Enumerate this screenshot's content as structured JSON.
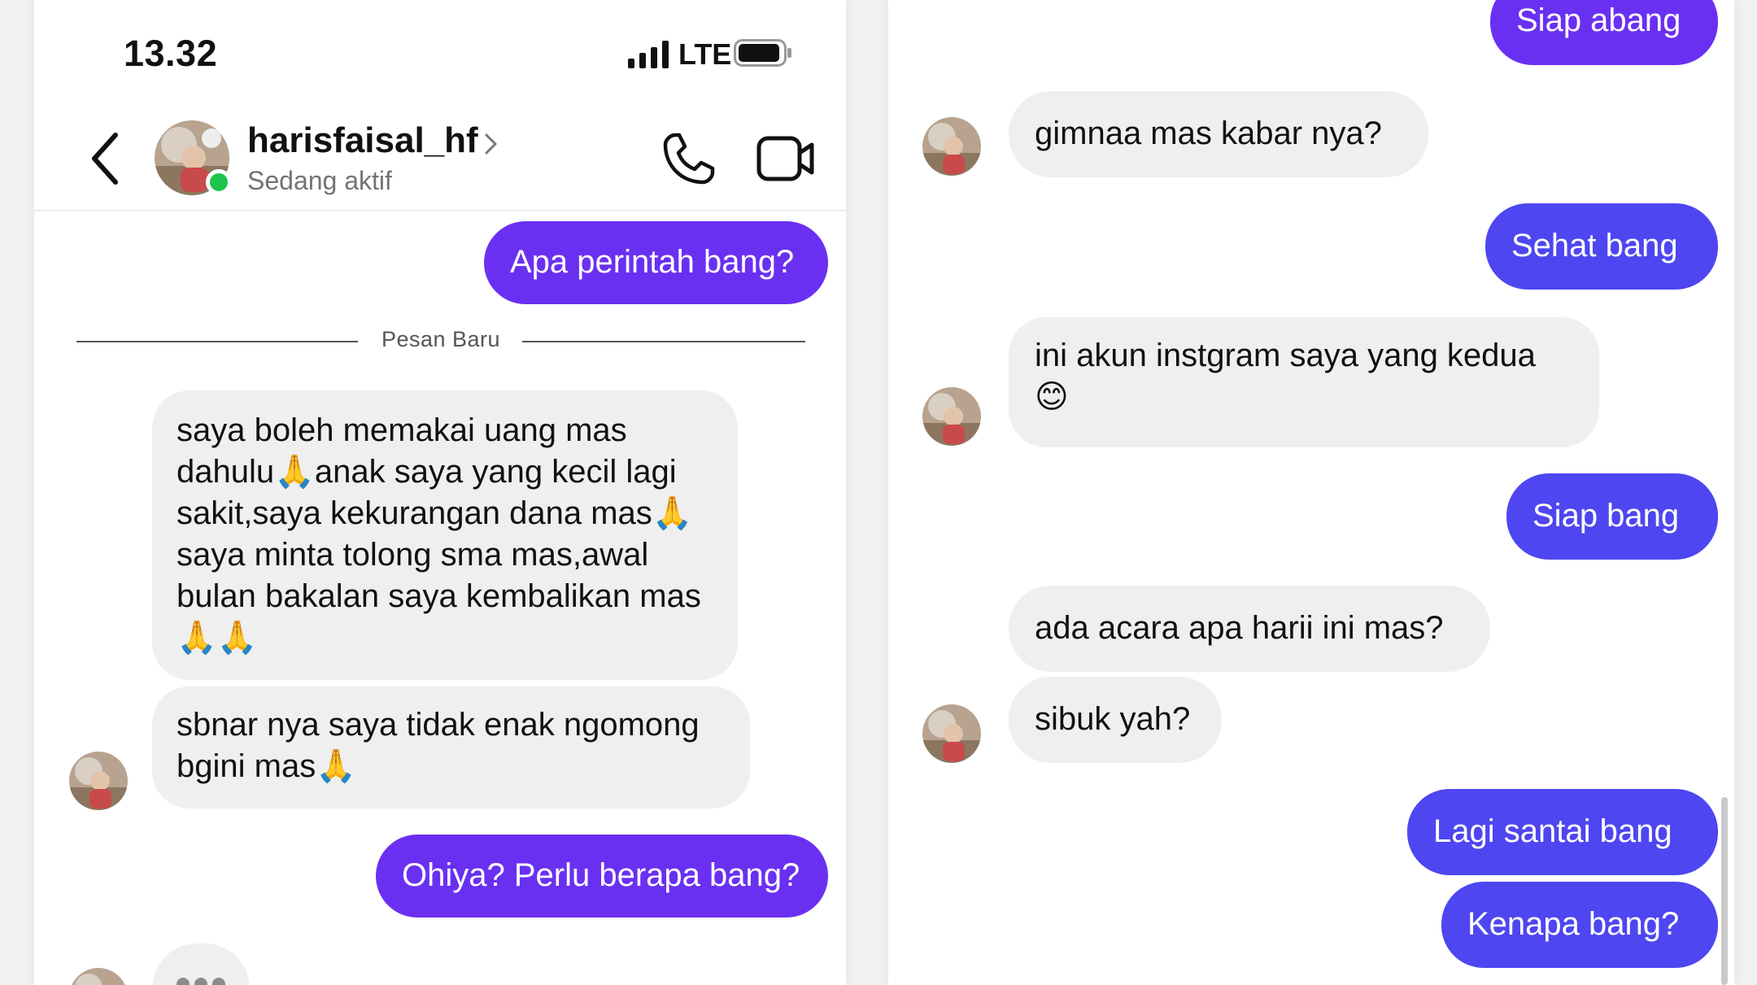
{
  "status_bar": {
    "time": "13.32",
    "network": "LTE",
    "icons": [
      "signal-icon",
      "battery-icon"
    ]
  },
  "header": {
    "username": "harisfaisal_hf",
    "status": "Sedang aktif",
    "icons": [
      "back-chevron-icon",
      "phone-icon",
      "video-camera-icon"
    ]
  },
  "colors": {
    "outgoing_bubble": "#6a30f2",
    "outgoing_bubble_blue": "#4e46f0",
    "incoming_bubble": "#efefef",
    "online": "#1ec44c"
  },
  "left_chat": {
    "messages": [
      {
        "from": "me",
        "text": "Apa perintah bang?"
      },
      {
        "from": "them",
        "lines": [
          "saya boleh memakai uang mas",
          "dahulu🙏anak saya yang kecil lagi",
          "sakit,saya kekurangan dana mas🙏",
          "saya minta tolong sma mas,awal",
          "bulan bakalan saya kembalikan mas",
          "🙏🙏"
        ]
      },
      {
        "from": "them",
        "lines": [
          "sbnar nya saya tidak enak ngomong",
          "bgini mas🙏"
        ]
      },
      {
        "from": "me",
        "text": "Ohiya? Perlu berapa bang?"
      }
    ],
    "divider_label": "Pesan Baru"
  },
  "right_chat": {
    "messages": [
      {
        "from": "me",
        "text": "Siap abang"
      },
      {
        "from": "them",
        "text": "gimnaa mas kabar nya?"
      },
      {
        "from": "me",
        "text": "Sehat bang"
      },
      {
        "from": "them",
        "lines": [
          "ini akun instgram saya yang kedua",
          "😊"
        ]
      },
      {
        "from": "me",
        "text": "Siap bang"
      },
      {
        "from": "them",
        "text": "ada acara apa harii ini mas?"
      },
      {
        "from": "them",
        "text": "sibuk yah?"
      },
      {
        "from": "me",
        "text": "Lagi santai bang"
      },
      {
        "from": "me",
        "text": "Kenapa bang?"
      }
    ]
  }
}
